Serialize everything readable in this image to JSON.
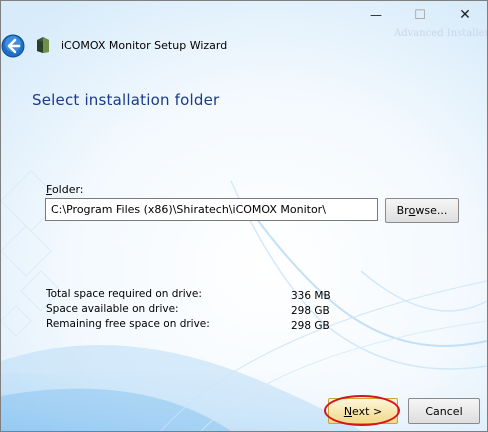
{
  "window": {
    "title": "iCOMOX Monitor Setup Wizard",
    "watermark": "Advanced Installer",
    "minimize_glyph": "—",
    "maximize_glyph": "☐",
    "close_glyph": "✕"
  },
  "page": {
    "heading": "Select installation folder"
  },
  "folder": {
    "label_prefix": "F",
    "label_rest": "older:",
    "path": "C:\\Program Files (x86)\\Shiratech\\iCOMOX Monitor\\",
    "browse_pre": "Br",
    "browse_key": "o",
    "browse_post": "wse..."
  },
  "space": {
    "required_label": "Total space required on drive:",
    "required_value": "336 MB",
    "available_label": "Space available on drive:",
    "available_value": "298 GB",
    "remaining_label": "Remaining free space on drive:",
    "remaining_value": "298 GB"
  },
  "buttons": {
    "next_key": "N",
    "next_rest": "ext >",
    "cancel": "Cancel"
  },
  "colors": {
    "heading": "#1a3a8c",
    "highlight": "#d6141b",
    "accent": "#1e73c8"
  }
}
